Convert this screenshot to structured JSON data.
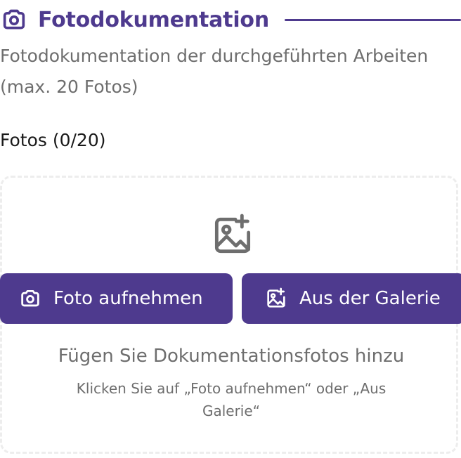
{
  "section": {
    "title": "Fotodokumentation",
    "description": "Fotodokumentation der durchgeführten Arbeiten (max. 20 Fotos)",
    "icon": "camera-icon",
    "accent_color": "#4e3a8e"
  },
  "photos": {
    "count_label": "Fotos (0/20)",
    "current": 0,
    "max": 20
  },
  "dropzone": {
    "icon": "image-plus-icon",
    "camera_button_label": "Foto aufnehmen",
    "camera_button_icon": "camera-icon",
    "gallery_button_label": "Aus der Galerie",
    "gallery_button_icon": "image-plus-icon",
    "empty_title": "Fügen Sie Dokumentationsfotos hinzu",
    "empty_hint": "Klicken Sie auf „Foto aufnehmen“ oder „Aus Galerie“"
  }
}
